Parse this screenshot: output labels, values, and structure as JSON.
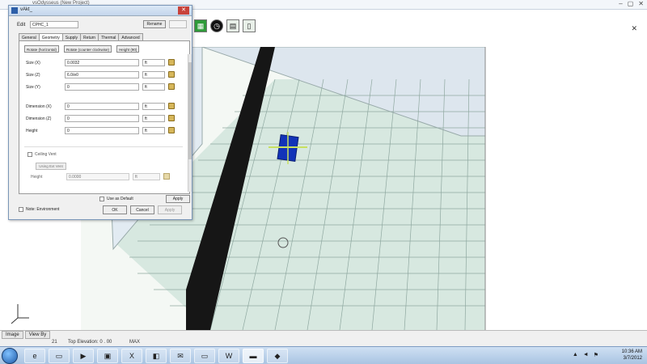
{
  "window": {
    "title": "vsOdysseus (New Project)",
    "close_glyph": "✕",
    "min_glyph": "–",
    "max_glyph": "▢"
  },
  "toolbar": {
    "icons": [
      "grid-icon",
      "clock-icon",
      "chart-icon",
      "page-icon"
    ]
  },
  "dialog": {
    "title": "vAkt_",
    "edit_label": "Edit",
    "edit_value": "CPHC_1",
    "rename_label": "Rename",
    "tabs": [
      "General",
      "Geometry",
      "Supply",
      "Return",
      "Thermal",
      "Advanced"
    ],
    "active_tab": "Geometry",
    "presets": [
      "Rotate (horizontal)",
      "Rotate (counter clockwise)",
      "Height (90)"
    ],
    "rows": [
      {
        "label": "Size (X)",
        "value": "0.0032",
        "unit": "ft"
      },
      {
        "label": "Size (Z)",
        "value": "6.0/e0",
        "unit": "ft"
      },
      {
        "label": "Size (Y)",
        "value": "0",
        "unit": "ft"
      },
      {
        "label": "Dimension (X)",
        "value": "0",
        "unit": "ft"
      },
      {
        "label": "Dimension (Z)",
        "value": "0",
        "unit": "ft"
      },
      {
        "label": "Height",
        "value": "0",
        "unit": "ft"
      }
    ],
    "ceiling_label": "Ceiling Vent",
    "ceiling_button": "Using Ext Vent",
    "ceiling_height_label": "Height",
    "ceiling_height_value": "0.0000",
    "ceiling_height_unit": "ft",
    "use_default_label": "Use as Default",
    "apply_label": "Apply",
    "note_label": "Note: Environment",
    "ok_label": "OK",
    "cancel_label": "Cancel",
    "help_label": "Apply"
  },
  "viewport": {
    "view_tabs": [
      "Image",
      "View By"
    ]
  },
  "status": {
    "left": "21",
    "middle": "Top Elevation: 0 . 00",
    "right": "MAX"
  },
  "taskbar": {
    "tasks": [
      "IE",
      "Folder",
      "Player",
      "Vb",
      "Excel",
      "Clip",
      "Mail",
      "Folder",
      "Word",
      "Active",
      "Odyssey"
    ],
    "time": "10:36 AM",
    "date": "3/7/2012"
  }
}
